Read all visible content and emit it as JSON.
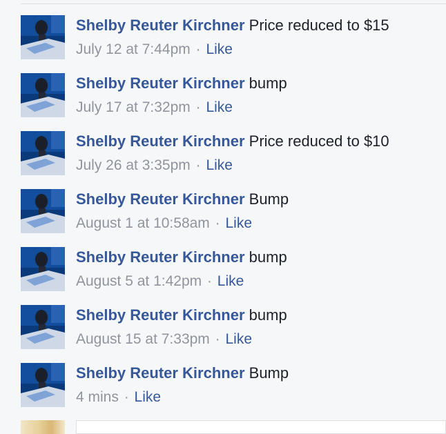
{
  "comments": [
    {
      "author": "Shelby Reuter Kirchner",
      "text": "Price reduced to $15",
      "time": "July 12 at 7:44pm",
      "sep": "·",
      "like": "Like"
    },
    {
      "author": "Shelby Reuter Kirchner",
      "text": "bump",
      "time": "July 17 at 7:32pm",
      "sep": "·",
      "like": "Like"
    },
    {
      "author": "Shelby Reuter Kirchner",
      "text": "Price reduced to $10",
      "time": "July 26 at 3:35pm",
      "sep": "·",
      "like": "Like"
    },
    {
      "author": "Shelby Reuter Kirchner",
      "text": "Bump",
      "time": "August 1 at 10:58am",
      "sep": "·",
      "like": "Like"
    },
    {
      "author": "Shelby Reuter Kirchner",
      "text": "bump",
      "time": "August 5 at 1:42pm",
      "sep": "·",
      "like": "Like"
    },
    {
      "author": "Shelby Reuter Kirchner",
      "text": "bump",
      "time": "August 15 at 7:33pm",
      "sep": "·",
      "like": "Like"
    },
    {
      "author": "Shelby Reuter Kirchner",
      "text": "Bump",
      "time": "4 mins",
      "sep": "·",
      "like": "Like"
    }
  ],
  "colors": {
    "author_link": "#365899",
    "body_text": "#1d2129",
    "meta_text": "#90949c",
    "background": "#f6f7f9"
  }
}
